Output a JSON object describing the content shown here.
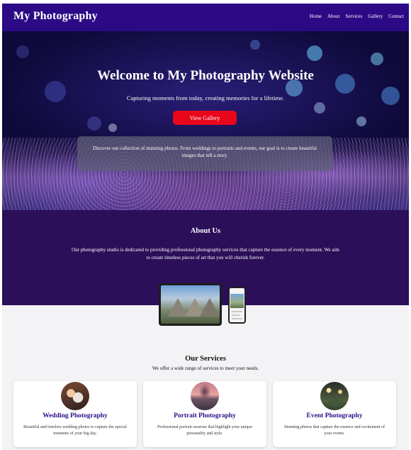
{
  "nav": {
    "brand": "My Photography",
    "links": [
      "Home",
      "About",
      "Services",
      "Gallery",
      "Contact"
    ]
  },
  "hero": {
    "title": "Welcome to My Photography Website",
    "subtitle": "Capturing moments from today, creating memories for a lifetime.",
    "button": "View Gallery",
    "intro": "Discover our collection of stunning photos. From weddings to portraits and events, our goal is to create beautiful images that tell a story."
  },
  "about": {
    "title": "About Us",
    "text": "Our photography studio is dedicated to providing professional photography services that capture the essence of every moment. We aim to create timeless pieces of art that you will cherish forever."
  },
  "services": {
    "title": "Our Services",
    "subtitle": "We offer a wide range of services to meet your needs.",
    "cards": [
      {
        "title": "Wedding Photography",
        "text": "Beautiful and timeless wedding photos to capture the special moments of your big day."
      },
      {
        "title": "Portrait Photography",
        "text": "Professional portrait sessions that highlight your unique personality and style."
      },
      {
        "title": "Event Photography",
        "text": "Stunning photos that capture the essence and excitement of your events."
      }
    ]
  },
  "colors": {
    "nav": "#2c0a86",
    "about_bg": "#2b0f59",
    "button": "#e8071a",
    "service_title": "#2c0a86"
  }
}
